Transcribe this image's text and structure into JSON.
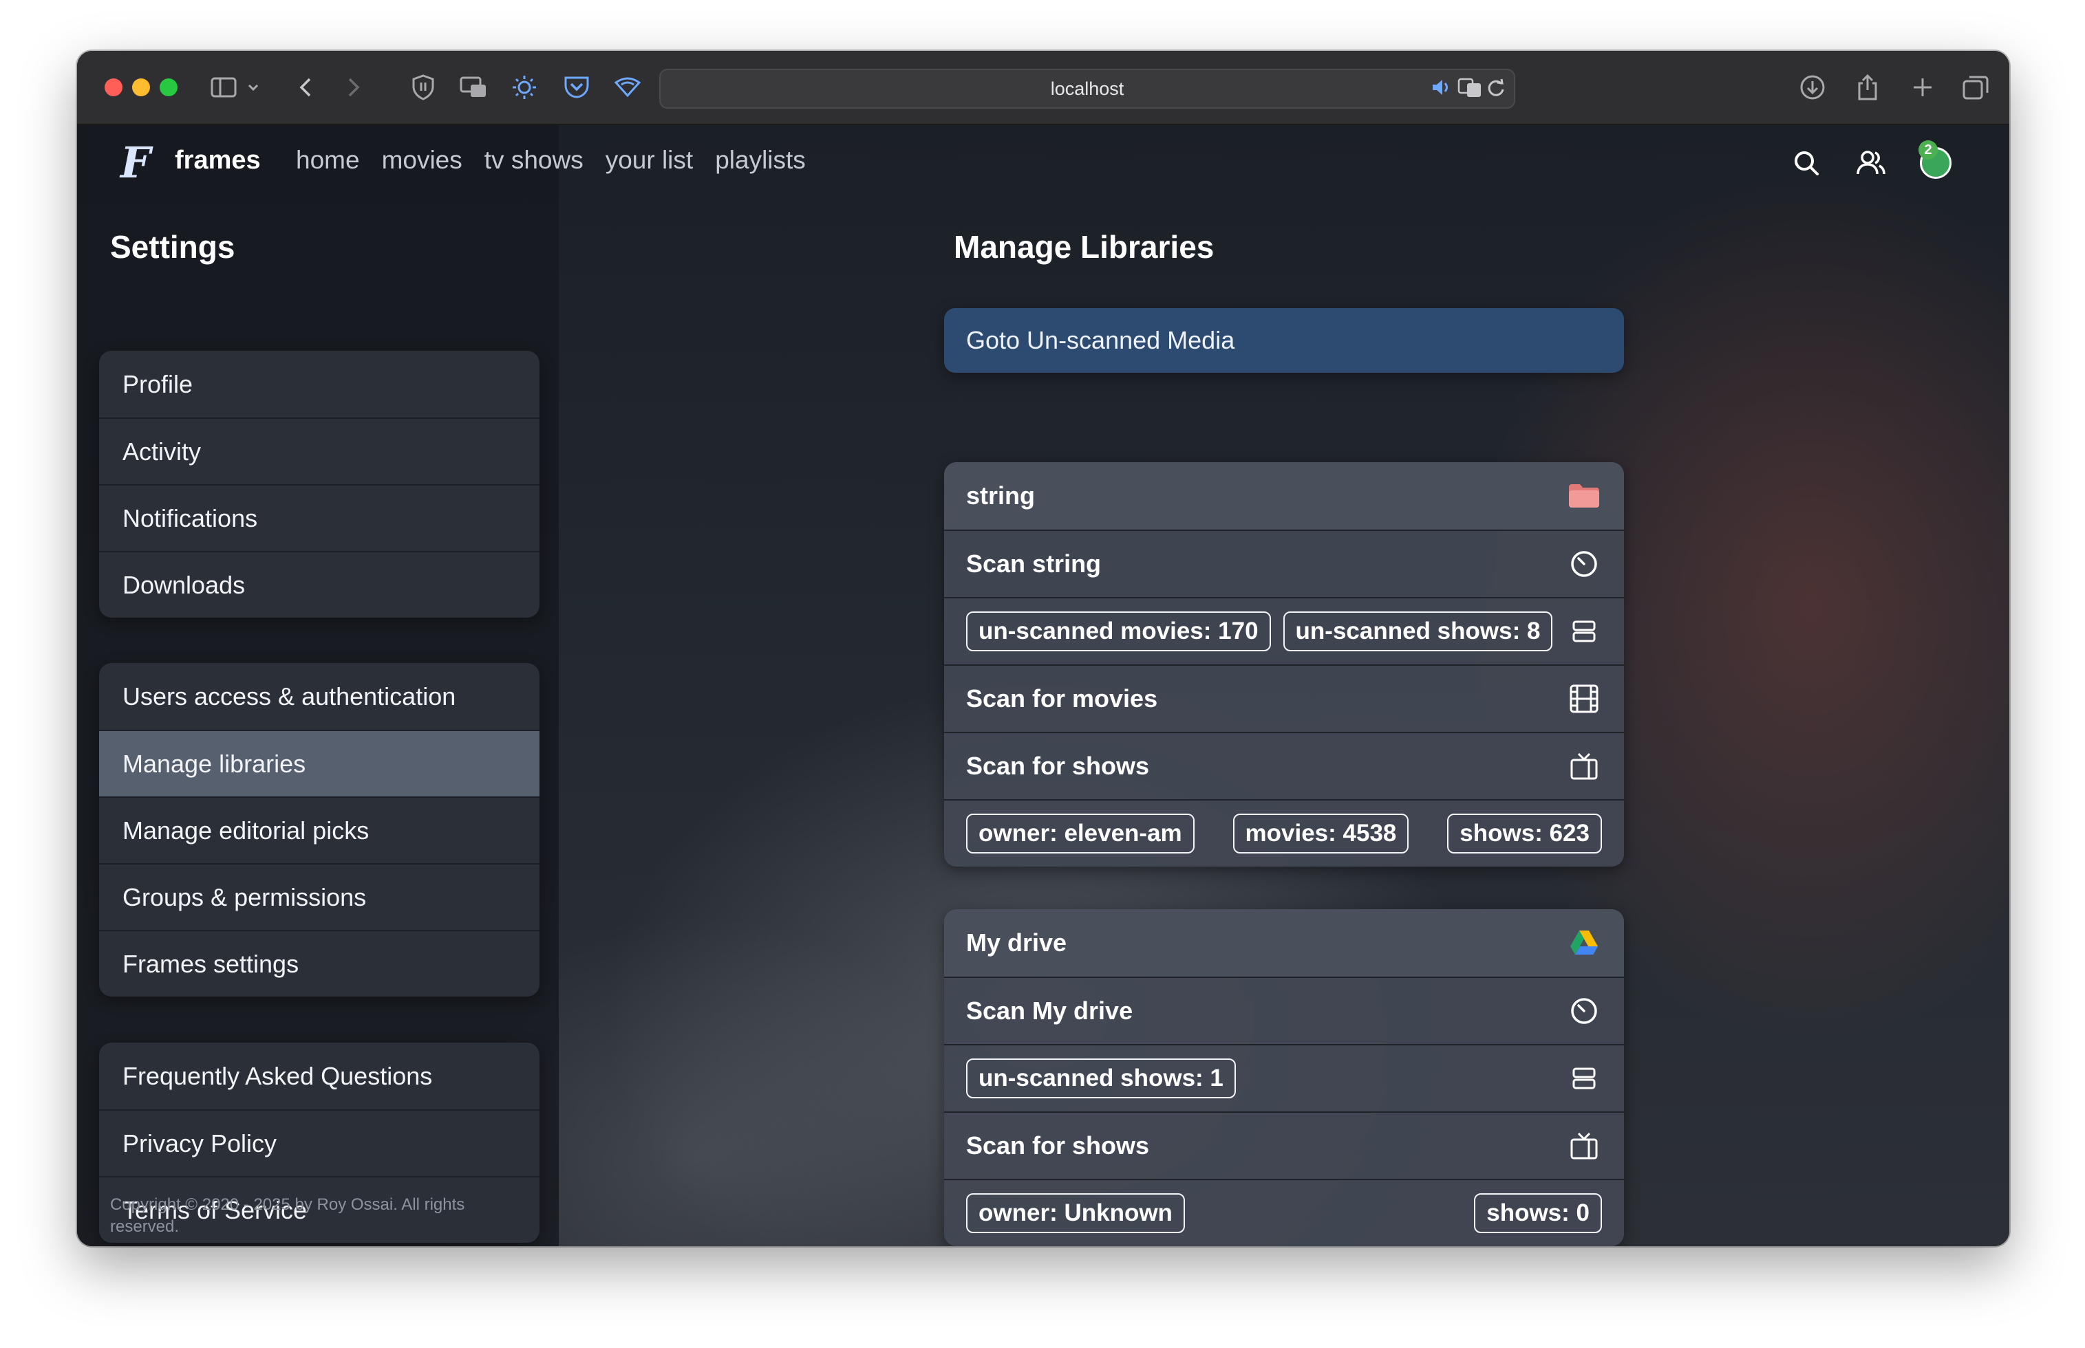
{
  "browser": {
    "url": "localhost",
    "traffic_colors": [
      "#ff5f57",
      "#febc2e",
      "#28c840"
    ]
  },
  "nav": {
    "brand": "frames",
    "logo_letter": "F",
    "links": [
      "home",
      "movies",
      "tv shows",
      "your list",
      "playlists"
    ],
    "notification_count": "2"
  },
  "sidebar": {
    "title": "Settings",
    "group1": [
      "Profile",
      "Activity",
      "Notifications",
      "Downloads"
    ],
    "group2": [
      "Users access & authentication",
      "Manage libraries",
      "Manage editorial picks",
      "Groups & permissions",
      "Frames settings"
    ],
    "group3": [
      "Frequently Asked Questions",
      "Privacy Policy",
      "Terms of Service"
    ],
    "active_item": "Manage libraries",
    "copyright": "Copyright © 2020 - 2025 by Roy Ossai. All rights reserved."
  },
  "main": {
    "title": "Manage Libraries",
    "goto_button": "Goto Un-scanned Media",
    "libraries": [
      {
        "name": "string",
        "icon": "folder-icon",
        "scan_label": "Scan string",
        "unscanned": [
          "un-scanned movies: 170",
          "un-scanned shows: 8"
        ],
        "scan_movies": "Scan for movies",
        "scan_shows": "Scan for shows",
        "owner": "owner: eleven-am",
        "movies": "movies: 4538",
        "shows": "shows: 623"
      },
      {
        "name": "My drive",
        "icon": "google-drive-icon",
        "scan_label": "Scan My drive",
        "unscanned": [
          "un-scanned shows: 1"
        ],
        "scan_shows": "Scan for shows",
        "owner": "owner: Unknown",
        "shows": "shows: 0"
      }
    ]
  },
  "colors": {
    "accent": "#2d4a70",
    "active_row": "#56606e",
    "badge": "#4caf50"
  }
}
